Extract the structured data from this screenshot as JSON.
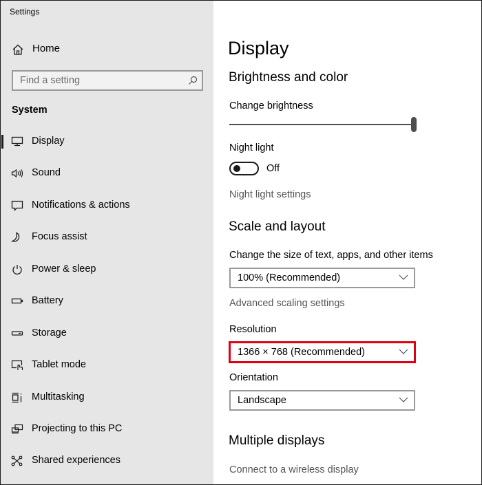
{
  "window": {
    "title": "Settings"
  },
  "sidebar": {
    "home_label": "Home",
    "search_placeholder": "Find a setting",
    "section": "System",
    "items": [
      {
        "label": "Display",
        "icon": "monitor-icon",
        "active": true
      },
      {
        "label": "Sound",
        "icon": "speaker-icon"
      },
      {
        "label": "Notifications & actions",
        "icon": "notification-icon"
      },
      {
        "label": "Focus assist",
        "icon": "moon-icon"
      },
      {
        "label": "Power & sleep",
        "icon": "power-icon"
      },
      {
        "label": "Battery",
        "icon": "battery-icon"
      },
      {
        "label": "Storage",
        "icon": "storage-icon"
      },
      {
        "label": "Tablet mode",
        "icon": "tablet-mode-icon"
      },
      {
        "label": "Multitasking",
        "icon": "multitasking-icon"
      },
      {
        "label": "Projecting to this PC",
        "icon": "projecting-icon"
      },
      {
        "label": "Shared experiences",
        "icon": "shared-experiences-icon"
      }
    ]
  },
  "main": {
    "title": "Display",
    "brightness_section": {
      "heading": "Brightness and color",
      "brightness_label": "Change brightness",
      "brightness_value_percent": 100,
      "night_light_label": "Night light",
      "night_light_state": "Off",
      "night_light_on": false,
      "night_light_settings_link": "Night light settings"
    },
    "scale_section": {
      "heading": "Scale and layout",
      "scale_label": "Change the size of text, apps, and other items",
      "scale_value": "100% (Recommended)",
      "advanced_link": "Advanced scaling settings",
      "resolution_label": "Resolution",
      "resolution_value": "1366 × 768 (Recommended)",
      "resolution_highlight_color": "#e0000f",
      "orientation_label": "Orientation",
      "orientation_value": "Landscape"
    },
    "multiple_displays_section": {
      "heading": "Multiple displays",
      "wireless_link": "Connect to a wireless display"
    }
  }
}
